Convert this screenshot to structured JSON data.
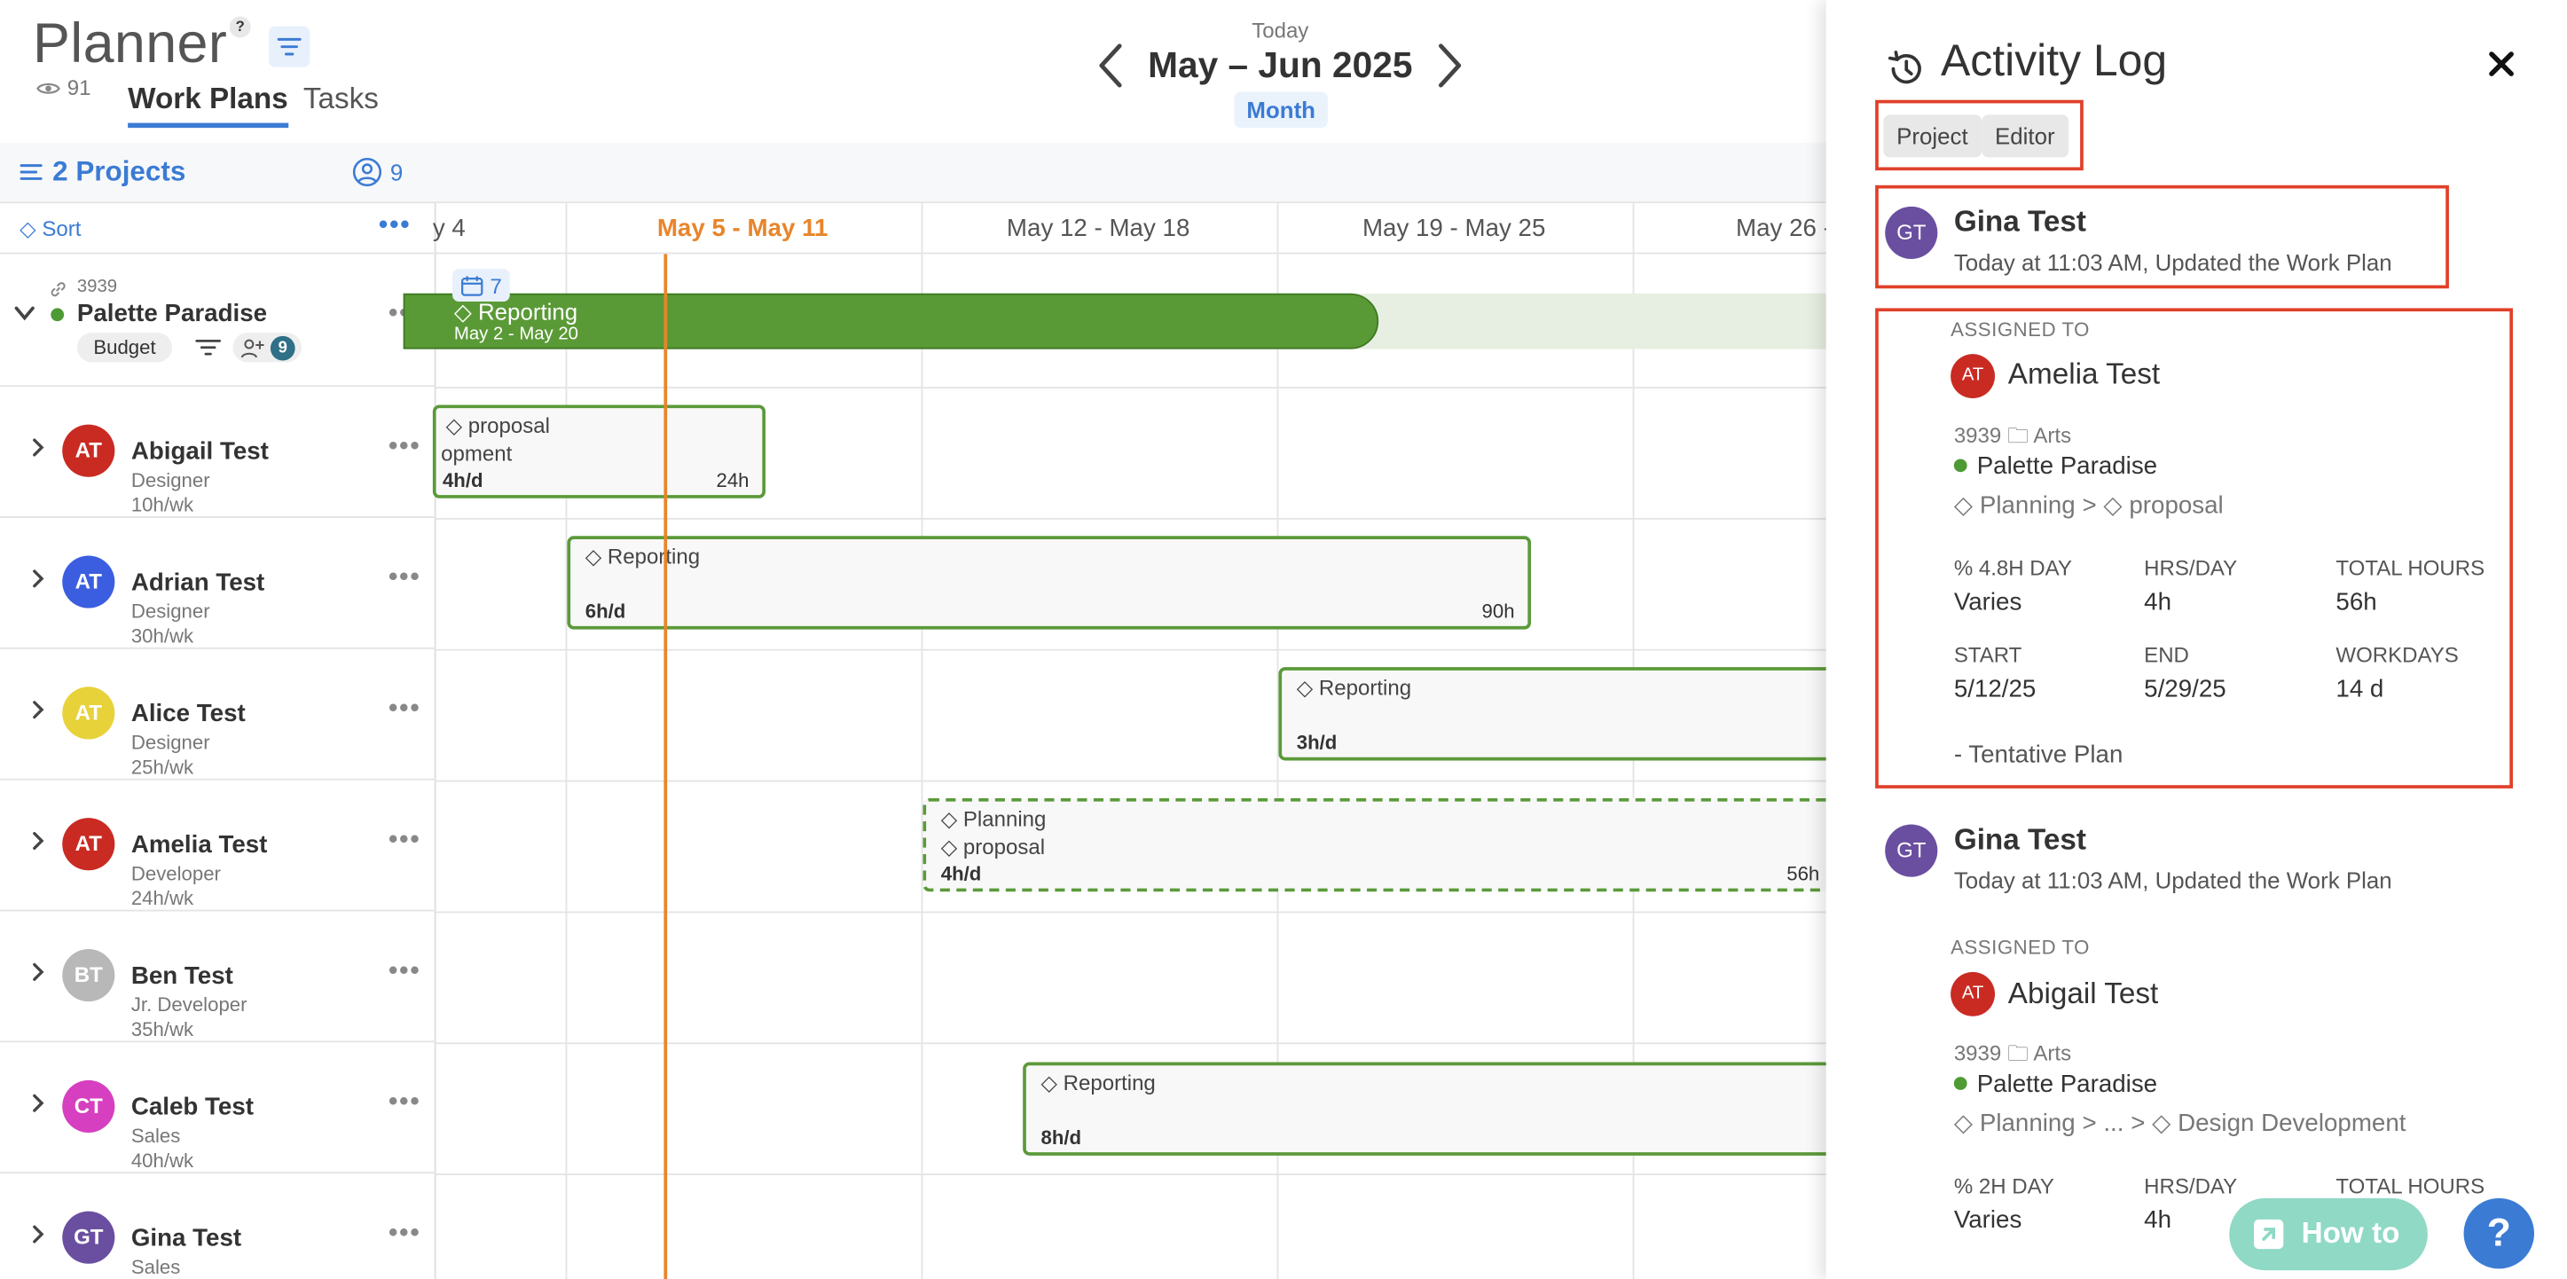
{
  "planner": {
    "title": "Planner",
    "help_badge": "?",
    "viewer_count": "91",
    "tabs": [
      "Work Plans",
      "Tasks"
    ],
    "today_label": "Today",
    "range_label": "May – Jun 2025",
    "view_mode": "Month",
    "projects_label": "2 Projects",
    "members_count": "9",
    "sort_label": "Sort",
    "more_label": "•••"
  },
  "project": {
    "number": "3939",
    "name": "Palette Paradise",
    "budget_label": "Budget",
    "member_badge": "9",
    "dot_color": "#4e9a34"
  },
  "week_labels": [
    "y 4",
    "May 5 - May 11",
    "May 12 - May 18",
    "May 19 - May 25",
    "May 26 -"
  ],
  "members": [
    {
      "initials": "AT",
      "name": "Abigail Test",
      "role": "Designer",
      "capacity": "10h/wk",
      "color": "#c92b23"
    },
    {
      "initials": "AT",
      "name": "Adrian Test",
      "role": "Designer",
      "capacity": "30h/wk",
      "color": "#3b5ee0"
    },
    {
      "initials": "AT",
      "name": "Alice Test",
      "role": "Designer",
      "capacity": "25h/wk",
      "color": "#e8d23a"
    },
    {
      "initials": "AT",
      "name": "Amelia Test",
      "role": "Developer",
      "capacity": "24h/wk",
      "color": "#c92b23"
    },
    {
      "initials": "BT",
      "name": "Ben Test",
      "role": "Jr. Developer",
      "capacity": "35h/wk",
      "color": "#b8b8b8"
    },
    {
      "initials": "CT",
      "name": "Caleb Test",
      "role": "Sales",
      "capacity": "40h/wk",
      "color": "#d63fc0"
    },
    {
      "initials": "GT",
      "name": "Gina Test",
      "role": "Sales",
      "capacity": "",
      "color": "#6a4fa0"
    }
  ],
  "bars": {
    "project_bar": {
      "count": "7",
      "phase": "Reporting",
      "dates": "May 2 - May 20"
    },
    "abigail": {
      "phase": "proposal",
      "phase2": "opment",
      "rate": "4h/d",
      "total": "24h"
    },
    "adrian": {
      "phase": "Reporting",
      "rate": "6h/d",
      "total": "90h"
    },
    "alice": {
      "phase": "Reporting",
      "rate": "3h/d"
    },
    "amelia": {
      "phase": "Planning",
      "phase2": "proposal",
      "rate": "4h/d",
      "total": "56h"
    },
    "caleb": {
      "phase": "Reporting",
      "rate": "8h/d"
    }
  },
  "activity": {
    "title": "Activity Log",
    "filters": [
      "Project",
      "Editor"
    ],
    "entries": [
      {
        "user_initials": "GT",
        "user": "Gina Test",
        "time": "Today at 11:03 AM, Updated the Work Plan",
        "assigned_label": "ASSIGNED TO",
        "assignee_initials": "AT",
        "assignee": "Amelia Test",
        "project_number": "3939",
        "folder": "Arts",
        "project": "Palette Paradise",
        "path_1": "Planning",
        "path_2": "proposal",
        "stats": {
          "pct_label": "% 4.8H DAY",
          "pct_value": "Varies",
          "hrs_label": "HRS/DAY",
          "hrs_value": "4h",
          "total_label": "TOTAL HOURS",
          "total_value": "56h",
          "start_label": "START",
          "start_value": "5/12/25",
          "end_label": "END",
          "end_value": "5/29/25",
          "workdays_label": "WORKDAYS",
          "workdays_value": "14 d"
        },
        "note": "- Tentative Plan"
      },
      {
        "user_initials": "GT",
        "user": "Gina Test",
        "time": "Today at 11:03 AM, Updated the Work Plan",
        "assigned_label": "ASSIGNED TO",
        "assignee_initials": "AT",
        "assignee": "Abigail Test",
        "project_number": "3939",
        "folder": "Arts",
        "project": "Palette Paradise",
        "path_1": "Planning",
        "path_mid": "...",
        "path_2": "Design Development",
        "stats": {
          "pct_label": "% 2H DAY",
          "pct_value": "Varies",
          "hrs_label": "HRS/DAY",
          "hrs_value": "4h",
          "total_label": "TOTAL HOURS"
        }
      }
    ],
    "howto_label": "How to",
    "help_fab": "?"
  },
  "colors": {
    "accent": "#3b7bd4",
    "today": "#e8852a",
    "bar": "#5b9a3a",
    "highlight": "#e0402a"
  }
}
